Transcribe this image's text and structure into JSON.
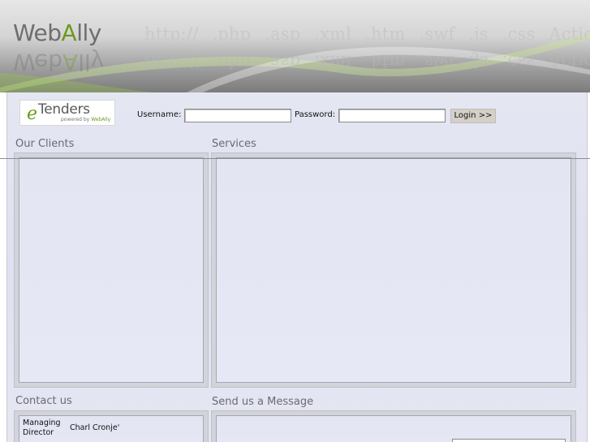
{
  "header": {
    "logo_prefix": "Web",
    "logo_accent": "A",
    "logo_suffix": "lly",
    "technologies": [
      "http://",
      ".php",
      ".asp",
      ".xml",
      ".htm",
      ".swf",
      ".js",
      ".css",
      "Actionscript"
    ]
  },
  "etenders": {
    "e": "e",
    "name": "Tenders",
    "powered_by": "powered by",
    "powered_brand": "WebAlly"
  },
  "login": {
    "username_label": "Username:",
    "username_value": "",
    "password_label": "Password:",
    "password_value": "",
    "button_label": "Login >>"
  },
  "sections": {
    "clients_title": "Our Clients",
    "services_title": "Services",
    "contact_title": "Contact us",
    "message_title": "Send us a Message"
  },
  "contact": {
    "role": "Managing Director",
    "name": "Charl Cronje'"
  },
  "colors": {
    "accent_green": "#6a9a1e",
    "panel_bg": "#e4e6f2",
    "title_gray": "#6a6a72"
  }
}
